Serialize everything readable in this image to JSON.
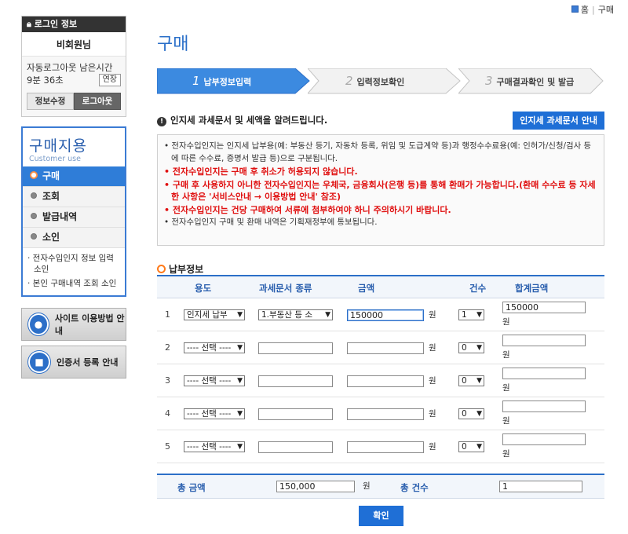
{
  "topnav": {
    "home": "홈",
    "sitemap": "구매"
  },
  "sidebar": {
    "login_title": "로그인 정보",
    "user_name": "비회원님",
    "auto_logout_label": "자동로그아웃 남은시간",
    "remaining_time": "9분 36초",
    "extend": "연장",
    "edit_info": "정보수정",
    "logout": "로그아웃",
    "menu_title": "구매지용",
    "menu_title_en": "Customer use",
    "menu": [
      {
        "label": "구매"
      },
      {
        "label": "조회"
      },
      {
        "label": "발급내역"
      },
      {
        "label": "소인"
      }
    ],
    "submenu": [
      {
        "label": "· 전자수입인지 정보 입력 소인"
      },
      {
        "label": "· 본인 구매내역 조회 소인"
      }
    ],
    "site_guide": "사이트 이용방법 안내",
    "cert_guide": "인증서 등록 안내"
  },
  "main": {
    "title": "구매",
    "steps": [
      {
        "num": "1",
        "label": "납부정보입력"
      },
      {
        "num": "2",
        "label": "입력정보확인"
      },
      {
        "num": "3",
        "label": "구매결과확인 및 발급"
      }
    ],
    "notice_title": "인지세 과세문서 및 세액을 알려드립니다.",
    "notice_button": "인지세 과세문서 안내",
    "notices": [
      {
        "text": "• 전자수입인지는 인지세 납부용(예: 부동산 등기, 자동차 등록, 위임 및 도급계약 등)과 행정수수료용(예: 인허가/신청/검사 등에 따른 수수료, 증명서 발급 등)으로 구분됩니다.",
        "red": false
      },
      {
        "text": "• 전자수입인지는 구매 후 취소가 허용되지 않습니다.",
        "red": true
      },
      {
        "text": "• 구매 후 사용하지 아니한 전자수입인지는 우체국, 금융회사(은행 등)를 통해 환매가 가능합니다.(환매 수수료 등 자세한 사항은 '서비스안내 → 이용방법 안내' 참조)",
        "red": true
      },
      {
        "text": "• 전자수입인지는 건당 구매하여 서류에 첨부하여야 하니 주의하시기 바랍니다.",
        "red": true
      },
      {
        "text": "• 전자수입인지 구매 및 환매 내역은 기획재정부에 통보됩니다.",
        "red": false
      }
    ],
    "section_title": "납부정보",
    "table": {
      "headers": {
        "usage": "용도",
        "doc_type": "과세문서 종류",
        "amount": "금액",
        "count": "건수",
        "sum": "합계금액"
      },
      "unit": "원",
      "rows": [
        {
          "no": "1",
          "usage": "인지세 납부",
          "doc_type": "1.부동산 등 소",
          "amount": "150000",
          "count": "1",
          "sum": "150000"
        },
        {
          "no": "2",
          "usage": "---- 선택 ----",
          "doc_type": "",
          "amount": "",
          "count": "0",
          "sum": ""
        },
        {
          "no": "3",
          "usage": "---- 선택 ----",
          "doc_type": "",
          "amount": "",
          "count": "0",
          "sum": ""
        },
        {
          "no": "4",
          "usage": "---- 선택 ----",
          "doc_type": "",
          "amount": "",
          "count": "0",
          "sum": ""
        },
        {
          "no": "5",
          "usage": "---- 선택 ----",
          "doc_type": "",
          "amount": "",
          "count": "0",
          "sum": ""
        }
      ]
    },
    "total": {
      "amount_label": "총 금액",
      "amount": "150,000",
      "unit": "원",
      "count_label": "총 건수",
      "count": "1"
    },
    "confirm": "확인"
  },
  "colors": {
    "accent": "#1f6fd6",
    "warning": "#e01010"
  }
}
